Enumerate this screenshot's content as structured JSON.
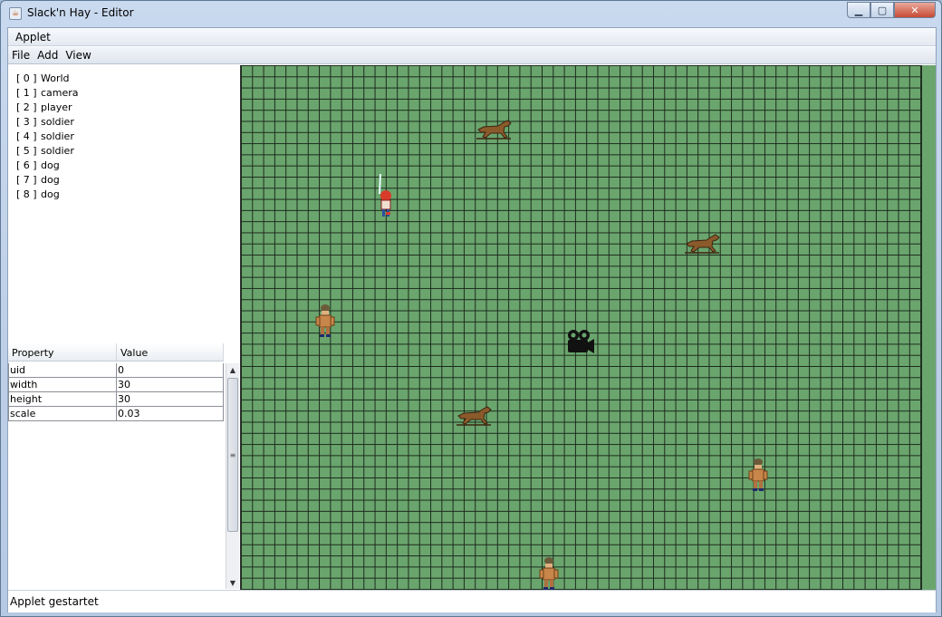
{
  "window": {
    "title": "Slack'n Hay - Editor",
    "minimize_glyph": "▁",
    "maximize_glyph": "▢",
    "close_glyph": "✕"
  },
  "menubar": {
    "top": "Applet",
    "items": [
      "File",
      "Add",
      "View"
    ]
  },
  "tree": {
    "items": [
      {
        "index": "[ 0 ]",
        "name": "World"
      },
      {
        "index": "[ 1 ]",
        "name": "camera"
      },
      {
        "index": "[ 2 ]",
        "name": "player"
      },
      {
        "index": "[ 3 ]",
        "name": "soldier"
      },
      {
        "index": "[ 4 ]",
        "name": "soldier"
      },
      {
        "index": "[ 5 ]",
        "name": "soldier"
      },
      {
        "index": "[ 6 ]",
        "name": "dog"
      },
      {
        "index": "[ 7 ]",
        "name": "dog"
      },
      {
        "index": "[ 8 ]",
        "name": "dog"
      }
    ]
  },
  "properties": {
    "headers": {
      "property": "Property",
      "value": "Value"
    },
    "rows": [
      {
        "property": "uid",
        "value": "0"
      },
      {
        "property": "width",
        "value": "30"
      },
      {
        "property": "height",
        "value": "30"
      },
      {
        "property": "scale",
        "value": "0.03"
      }
    ]
  },
  "canvas": {
    "background_color": "#6aa56d",
    "grid_color": "#1c2a1c",
    "sprites": [
      {
        "kind": "dog-icon"
      },
      {
        "kind": "player-icon"
      },
      {
        "kind": "dog-icon"
      },
      {
        "kind": "soldier-icon"
      },
      {
        "kind": "camera-icon"
      },
      {
        "kind": "dog-icon"
      },
      {
        "kind": "soldier-icon"
      },
      {
        "kind": "soldier-icon"
      }
    ]
  },
  "status": {
    "text": "Applet gestartet"
  }
}
